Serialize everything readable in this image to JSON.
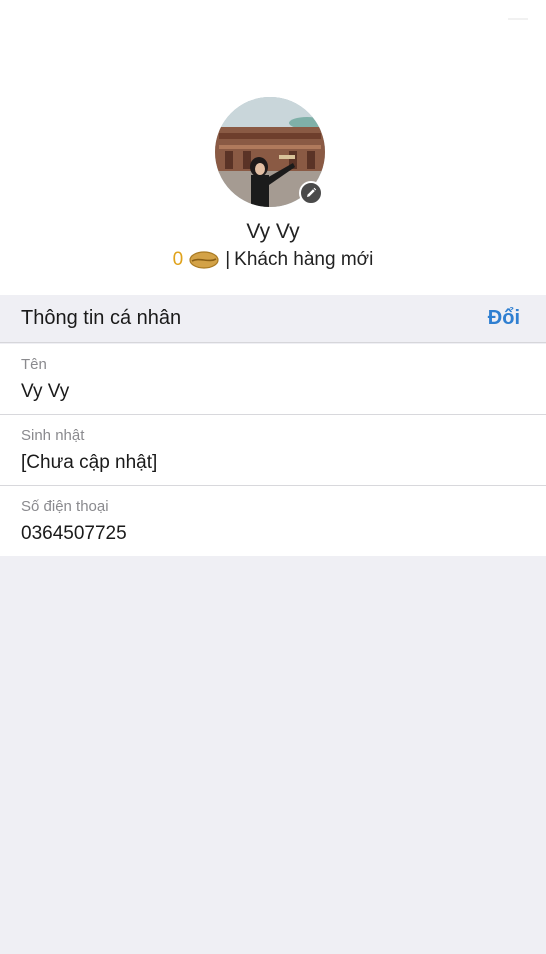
{
  "profile": {
    "name": "Vy Vy",
    "points": "0",
    "separator": "|",
    "tier": "Khách hàng mới",
    "avatar_icon": "user-photo",
    "edit_icon": "pencil-icon",
    "points_icon": "coffee-bean-icon"
  },
  "section": {
    "title": "Thông tin cá nhân",
    "action_label": "Đổi"
  },
  "fields": [
    {
      "label": "Tên",
      "value": "Vy Vy"
    },
    {
      "label": "Sinh nhật",
      "value": "[Chưa cập nhật]"
    },
    {
      "label": "Số điện thoại",
      "value": "0364507725"
    }
  ],
  "colors": {
    "accent": "#2f7fd1",
    "points": "#e0a21b",
    "background": "#efeff4"
  }
}
